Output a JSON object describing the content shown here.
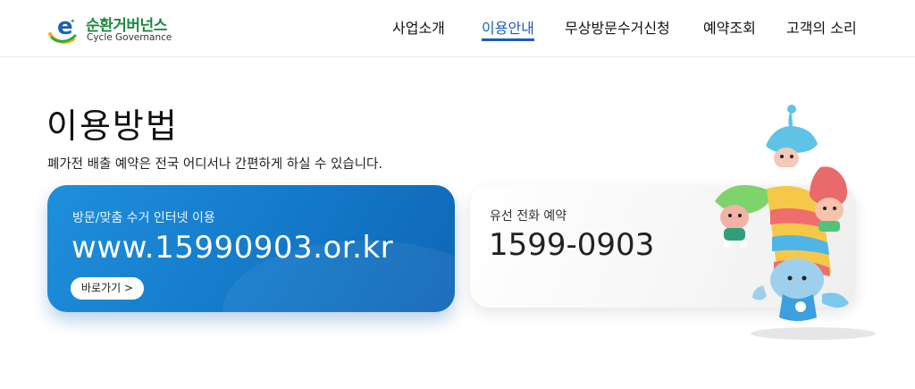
{
  "header": {
    "logo": {
      "ko": "순환거버넌스",
      "en": "Cycle Governance"
    },
    "nav": [
      {
        "label": "사업소개",
        "active": false
      },
      {
        "label": "이용안내",
        "active": true
      },
      {
        "label": "무상방문수거신청",
        "active": false
      },
      {
        "label": "예약조회",
        "active": false
      },
      {
        "label": "고객의 소리",
        "active": false
      }
    ]
  },
  "main": {
    "title": "이용방법",
    "description": "폐가전 배출 예약은 전국 어디서나 간편하게 하실 수 있습니다.",
    "online_card": {
      "label": "방문/맞춤 수거 인터넷 이용",
      "url": "www.15990903.or.kr",
      "button": "바로가기 >"
    },
    "phone_card": {
      "label": "유선 전화 예약",
      "number": "1599-0903"
    }
  },
  "colors": {
    "accent": "#1a5fb4",
    "card_blue": "#1479c9",
    "logo_green": "#1d8a3f"
  },
  "icons": [
    "cycle-governance-logo-mark",
    "mascot-characters"
  ]
}
